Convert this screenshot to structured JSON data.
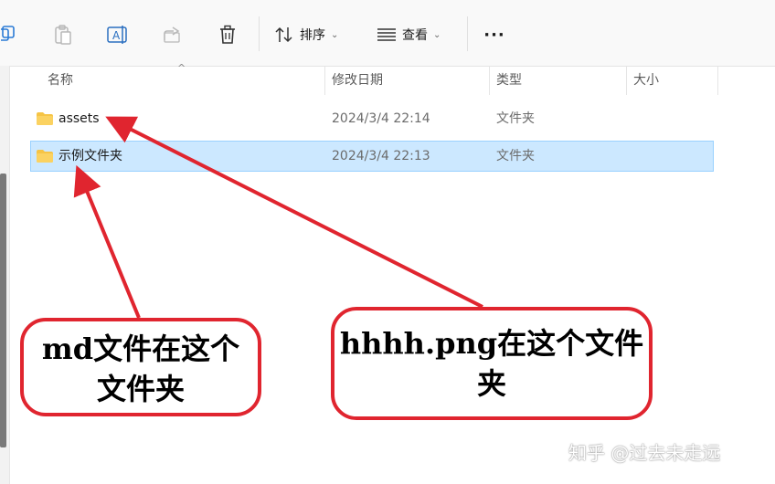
{
  "toolbar": {
    "sort_label": "排序",
    "view_label": "查看",
    "more_label": "···"
  },
  "columns": {
    "name": "名称",
    "modified": "修改日期",
    "type": "类型",
    "size": "大小"
  },
  "files": [
    {
      "name": "assets",
      "modified": "2024/3/4 22:14",
      "type": "文件夹",
      "size": "",
      "selected": false
    },
    {
      "name": "示例文件夹",
      "modified": "2024/3/4 22:13",
      "type": "文件夹",
      "size": "",
      "selected": true
    }
  ],
  "annotations": {
    "left_callout_line1": "md文件在这个",
    "left_callout_line2": "文件夹",
    "right_callout_line1": "hhhh.png在这个文件",
    "right_callout_line2": "夹"
  },
  "watermark": "知乎 @过去未走远",
  "colors": {
    "accent_red": "#e0252f",
    "selection": "#cce8ff",
    "folder": "#f6c445"
  }
}
